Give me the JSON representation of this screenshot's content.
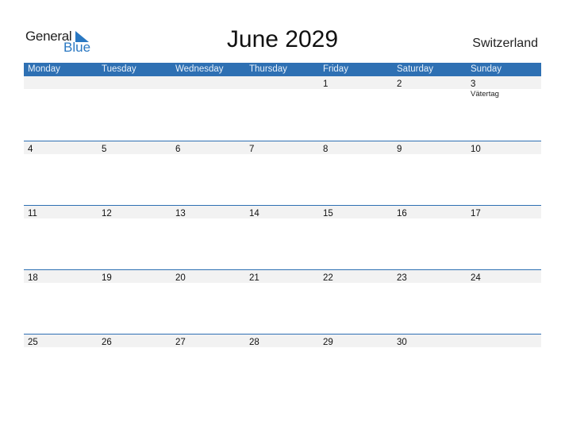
{
  "logo": {
    "general": "General",
    "blue": "Blue",
    "icon": "triangle-flag-icon",
    "accent": "#2a78c2"
  },
  "title": "June 2029",
  "country": "Switzerland",
  "colors": {
    "header_bg": "#2e70b3",
    "band_bg": "#f2f2f2"
  },
  "weekdays": [
    "Monday",
    "Tuesday",
    "Wednesday",
    "Thursday",
    "Friday",
    "Saturday",
    "Sunday"
  ],
  "weeks": [
    {
      "days": [
        "",
        "",
        "",
        "",
        "1",
        "2",
        "3"
      ],
      "holidays": [
        "",
        "",
        "",
        "",
        "",
        "",
        "Vätertag"
      ]
    },
    {
      "days": [
        "4",
        "5",
        "6",
        "7",
        "8",
        "9",
        "10"
      ],
      "holidays": [
        "",
        "",
        "",
        "",
        "",
        "",
        ""
      ]
    },
    {
      "days": [
        "11",
        "12",
        "13",
        "14",
        "15",
        "16",
        "17"
      ],
      "holidays": [
        "",
        "",
        "",
        "",
        "",
        "",
        ""
      ]
    },
    {
      "days": [
        "18",
        "19",
        "20",
        "21",
        "22",
        "23",
        "24"
      ],
      "holidays": [
        "",
        "",
        "",
        "",
        "",
        "",
        ""
      ]
    },
    {
      "days": [
        "25",
        "26",
        "27",
        "28",
        "29",
        "30",
        ""
      ],
      "holidays": [
        "",
        "",
        "",
        "",
        "",
        "",
        ""
      ]
    }
  ]
}
